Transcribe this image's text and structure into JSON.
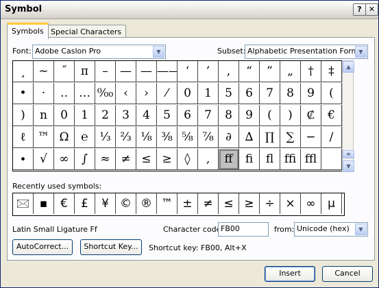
{
  "window": {
    "title": "Symbol",
    "help_btn": "?",
    "close_btn": "✕"
  },
  "tabs": [
    {
      "label": "Symbols"
    },
    {
      "label": "Special Characters"
    }
  ],
  "font": {
    "label": "Font:",
    "value": "Adobe Caslon Pro"
  },
  "subset": {
    "label": "Subset:",
    "value": "Alphabetic Presentation Forms"
  },
  "symbols": [
    [
      "¸",
      "~",
      "˝",
      "π",
      "–",
      "—",
      "—",
      "——",
      "‘",
      "’",
      ",",
      "“",
      "”",
      "„",
      "†",
      "‡"
    ],
    [
      "•",
      "·",
      "‥",
      "…",
      "⁰⁄₀₀",
      "‹",
      "›",
      "⁄",
      "0",
      "1",
      "5",
      "6",
      "7",
      "8",
      "9",
      "("
    ],
    [
      ")",
      "n",
      "0",
      "1",
      "2",
      "3",
      "4",
      "5",
      "6",
      "7",
      "8",
      "9",
      "(",
      ")",
      "₡",
      "€"
    ],
    [
      "ℓ",
      "™",
      "Ω",
      "℮",
      "⅓",
      "⅔",
      "⅛",
      "⅜",
      "⅝",
      "⅞",
      "∂",
      "∆",
      "∏",
      "∑",
      "−",
      "∕"
    ],
    [
      "∙",
      "√",
      "∞",
      "∫",
      "≈",
      "≠",
      "≤",
      "≥",
      "◊",
      "‚",
      "ﬀ",
      "ﬁ",
      "ﬂ",
      "ﬃ",
      "ﬄ",
      ""
    ]
  ],
  "recent": {
    "label": "Recently used symbols:",
    "items": [
      "🖂",
      "▪",
      "€",
      "£",
      "¥",
      "©",
      "®",
      "™",
      "±",
      "≠",
      "≤",
      "≥",
      "÷",
      "×",
      "∞",
      "µ"
    ]
  },
  "selected_name": "Latin Small Ligature Ff",
  "char_code": {
    "label": "Character code:",
    "value": "FB00"
  },
  "from": {
    "label": "from:",
    "value": "Unicode (hex)"
  },
  "autocorrect_btn": "AutoCorrect...",
  "shortcut_btn": "Shortcut Key...",
  "shortcut_text": "Shortcut key: FB00, Alt+X",
  "insert_btn": "Insert",
  "cancel_btn": "Cancel"
}
